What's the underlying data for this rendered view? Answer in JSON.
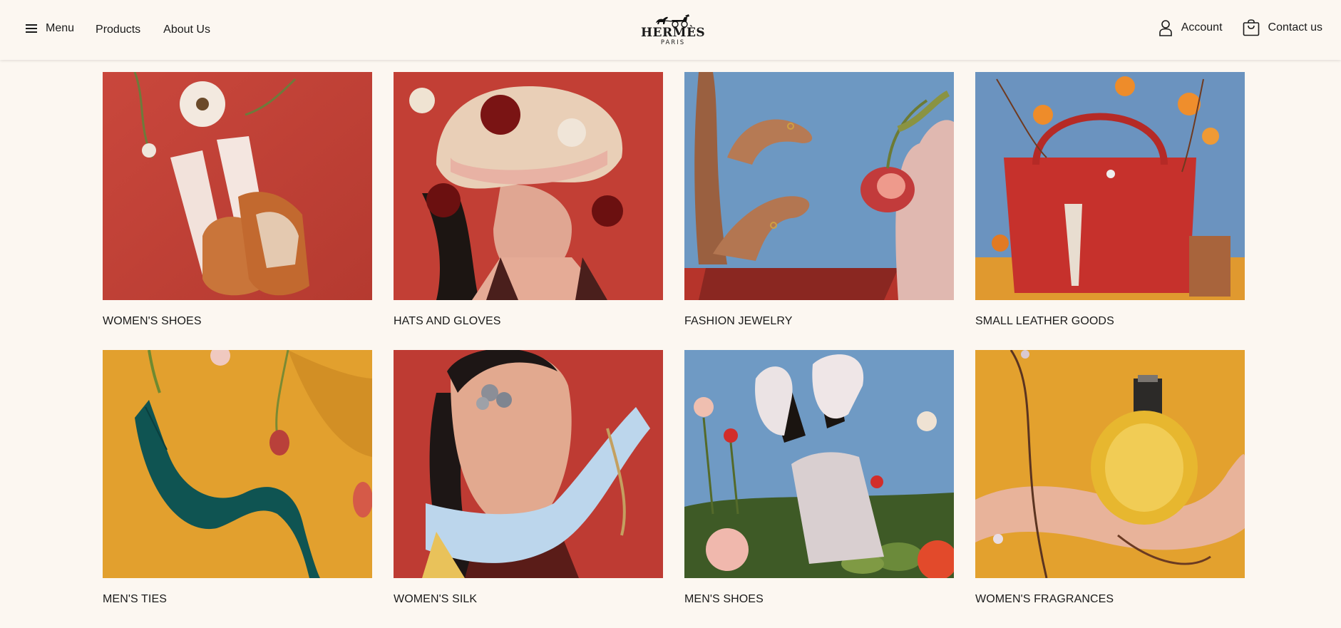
{
  "header": {
    "menu_label": "Menu",
    "nav_links": [
      "Products",
      "About Us"
    ],
    "logo_word": "HERMÈS",
    "logo_sub": "PARIS",
    "account_label": "Account",
    "contact_label": "Contact us"
  },
  "colors": {
    "background": "#fcf7f1",
    "red_backdrop": "#c4473a",
    "blue_backdrop": "#6e99c4",
    "orange_backdrop": "#e2a02e"
  },
  "categories": [
    {
      "label": "WOMEN'S SHOES",
      "backdrop": "red"
    },
    {
      "label": "HATS AND GLOVES",
      "backdrop": "red"
    },
    {
      "label": "FASHION JEWELRY",
      "backdrop": "blue"
    },
    {
      "label": "SMALL LEATHER GOODS",
      "backdrop": "blue"
    },
    {
      "label": "MEN'S TIES",
      "backdrop": "orange"
    },
    {
      "label": "WOMEN'S SILK",
      "backdrop": "red"
    },
    {
      "label": "MEN'S SHOES",
      "backdrop": "blue"
    },
    {
      "label": "WOMEN'S FRAGRANCES",
      "backdrop": "orange"
    }
  ]
}
